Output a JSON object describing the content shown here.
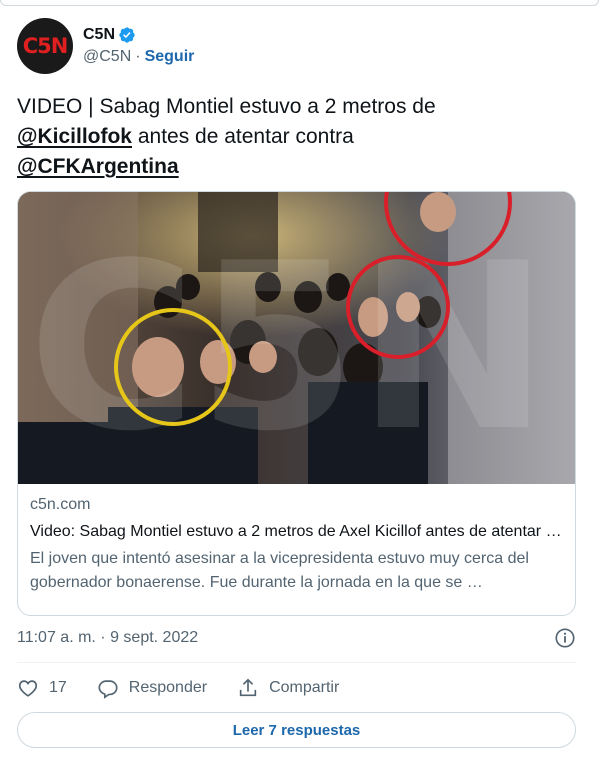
{
  "author": {
    "display_name": "C5N",
    "handle": "@C5N",
    "separator": "·",
    "follow_label": "Seguir",
    "avatar_text": "C5N",
    "verified": true
  },
  "tweet": {
    "text_prefix": "VIDEO | Sabag Montiel estuvo a 2 metros de",
    "mention_1": "@Kicillofok",
    "text_middle": "antes de atentar contra",
    "mention_2": "@CFKArgentina"
  },
  "card": {
    "domain": "c5n.com",
    "title": "Video: Sabag Montiel estuvo a 2 metros de Axel Kicillof antes de atentar contra Cristina",
    "description": "El joven que intentó asesinar a la vicepresidenta estuvo muy cerca del gobernador bonaerense. Fue durante la jornada en la que se …",
    "media_watermark": "C5N",
    "image_alt": "crowd photo with circled faces"
  },
  "meta": {
    "timestamp": "11:07 a. m. · 9 sept. 2022"
  },
  "actions": {
    "like_count": "17",
    "reply_label": "Responder",
    "share_label": "Compartir"
  },
  "footer": {
    "read_replies_label": "Leer 7 respuestas"
  },
  "colors": {
    "link_blue": "#1d68ad",
    "verified_blue": "#1d9bf0",
    "muted_text": "#536471",
    "border": "#cfd9de",
    "circle_yellow": "#e6c619",
    "circle_red": "#d91f2a"
  }
}
